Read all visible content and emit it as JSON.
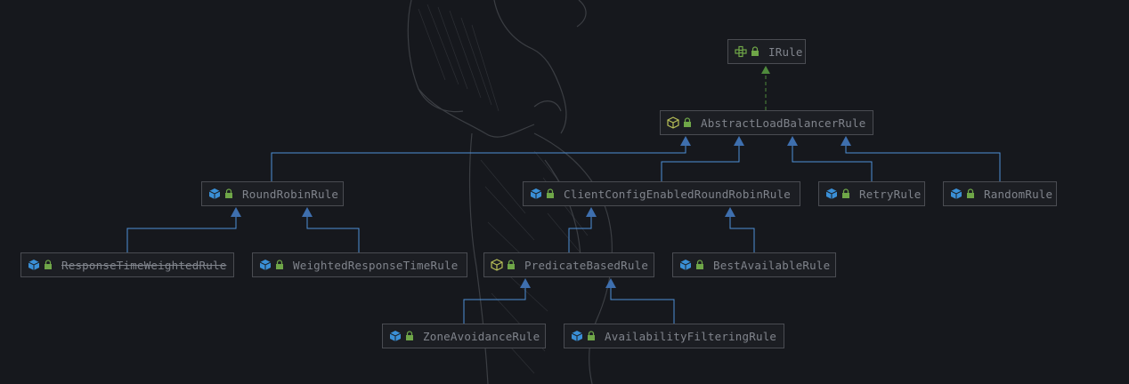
{
  "colors": {
    "background": "#16181d",
    "node_border": "#4a4c52",
    "node_text": "#80848c",
    "extends_edge": "#4d8fd6",
    "implements_edge": "#4f8a3c",
    "class_icon": "#3a8fd6",
    "abstract_icon": "#b8c058",
    "interface_icon": "#6fa648",
    "lock_icon": "#6fa648"
  },
  "diagram": {
    "nodes": [
      {
        "id": "IRule",
        "label": "IRule",
        "kind": "interface"
      },
      {
        "id": "AbstractLoadBalancerRule",
        "label": "AbstractLoadBalancerRule",
        "kind": "abstract"
      },
      {
        "id": "RoundRobinRule",
        "label": "RoundRobinRule",
        "kind": "class"
      },
      {
        "id": "ClientConfigEnabledRoundRobinRule",
        "label": "ClientConfigEnabledRoundRobinRule",
        "kind": "class"
      },
      {
        "id": "RetryRule",
        "label": "RetryRule",
        "kind": "class"
      },
      {
        "id": "RandomRule",
        "label": "RandomRule",
        "kind": "class"
      },
      {
        "id": "ResponseTimeWeightedRule",
        "label": "ResponseTimeWeightedRule",
        "kind": "class",
        "deprecated": true
      },
      {
        "id": "WeightedResponseTimeRule",
        "label": "WeightedResponseTimeRule",
        "kind": "class"
      },
      {
        "id": "PredicateBasedRule",
        "label": "PredicateBasedRule",
        "kind": "abstract"
      },
      {
        "id": "BestAvailableRule",
        "label": "BestAvailableRule",
        "kind": "class"
      },
      {
        "id": "ZoneAvoidanceRule",
        "label": "ZoneAvoidanceRule",
        "kind": "class"
      },
      {
        "id": "AvailabilityFilteringRule",
        "label": "AvailabilityFilteringRule",
        "kind": "class"
      }
    ],
    "edges": [
      {
        "from": "AbstractLoadBalancerRule",
        "to": "IRule",
        "type": "implements"
      },
      {
        "from": "RoundRobinRule",
        "to": "AbstractLoadBalancerRule",
        "type": "extends"
      },
      {
        "from": "ClientConfigEnabledRoundRobinRule",
        "to": "AbstractLoadBalancerRule",
        "type": "extends"
      },
      {
        "from": "RetryRule",
        "to": "AbstractLoadBalancerRule",
        "type": "extends"
      },
      {
        "from": "RandomRule",
        "to": "AbstractLoadBalancerRule",
        "type": "extends"
      },
      {
        "from": "ResponseTimeWeightedRule",
        "to": "RoundRobinRule",
        "type": "extends"
      },
      {
        "from": "WeightedResponseTimeRule",
        "to": "RoundRobinRule",
        "type": "extends"
      },
      {
        "from": "PredicateBasedRule",
        "to": "ClientConfigEnabledRoundRobinRule",
        "type": "extends"
      },
      {
        "from": "BestAvailableRule",
        "to": "ClientConfigEnabledRoundRobinRule",
        "type": "extends"
      },
      {
        "from": "ZoneAvoidanceRule",
        "to": "PredicateBasedRule",
        "type": "extends"
      },
      {
        "from": "AvailabilityFilteringRule",
        "to": "PredicateBasedRule",
        "type": "extends"
      }
    ]
  }
}
